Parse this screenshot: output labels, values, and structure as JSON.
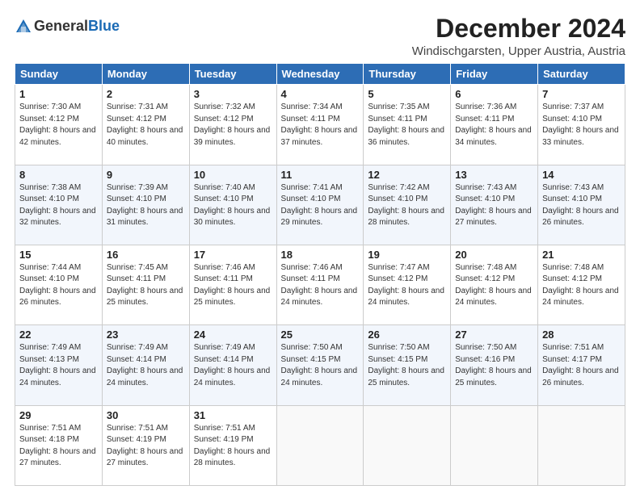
{
  "logo": {
    "line1": "General",
    "line2": "Blue"
  },
  "header": {
    "title": "December 2024",
    "subtitle": "Windischgarsten, Upper Austria, Austria"
  },
  "weekdays": [
    "Sunday",
    "Monday",
    "Tuesday",
    "Wednesday",
    "Thursday",
    "Friday",
    "Saturday"
  ],
  "weeks": [
    [
      {
        "day": "1",
        "sunrise": "7:30 AM",
        "sunset": "4:12 PM",
        "daylight": "8 hours and 42 minutes."
      },
      {
        "day": "2",
        "sunrise": "7:31 AM",
        "sunset": "4:12 PM",
        "daylight": "8 hours and 40 minutes."
      },
      {
        "day": "3",
        "sunrise": "7:32 AM",
        "sunset": "4:12 PM",
        "daylight": "8 hours and 39 minutes."
      },
      {
        "day": "4",
        "sunrise": "7:34 AM",
        "sunset": "4:11 PM",
        "daylight": "8 hours and 37 minutes."
      },
      {
        "day": "5",
        "sunrise": "7:35 AM",
        "sunset": "4:11 PM",
        "daylight": "8 hours and 36 minutes."
      },
      {
        "day": "6",
        "sunrise": "7:36 AM",
        "sunset": "4:11 PM",
        "daylight": "8 hours and 34 minutes."
      },
      {
        "day": "7",
        "sunrise": "7:37 AM",
        "sunset": "4:10 PM",
        "daylight": "8 hours and 33 minutes."
      }
    ],
    [
      {
        "day": "8",
        "sunrise": "7:38 AM",
        "sunset": "4:10 PM",
        "daylight": "8 hours and 32 minutes."
      },
      {
        "day": "9",
        "sunrise": "7:39 AM",
        "sunset": "4:10 PM",
        "daylight": "8 hours and 31 minutes."
      },
      {
        "day": "10",
        "sunrise": "7:40 AM",
        "sunset": "4:10 PM",
        "daylight": "8 hours and 30 minutes."
      },
      {
        "day": "11",
        "sunrise": "7:41 AM",
        "sunset": "4:10 PM",
        "daylight": "8 hours and 29 minutes."
      },
      {
        "day": "12",
        "sunrise": "7:42 AM",
        "sunset": "4:10 PM",
        "daylight": "8 hours and 28 minutes."
      },
      {
        "day": "13",
        "sunrise": "7:43 AM",
        "sunset": "4:10 PM",
        "daylight": "8 hours and 27 minutes."
      },
      {
        "day": "14",
        "sunrise": "7:43 AM",
        "sunset": "4:10 PM",
        "daylight": "8 hours and 26 minutes."
      }
    ],
    [
      {
        "day": "15",
        "sunrise": "7:44 AM",
        "sunset": "4:10 PM",
        "daylight": "8 hours and 26 minutes."
      },
      {
        "day": "16",
        "sunrise": "7:45 AM",
        "sunset": "4:11 PM",
        "daylight": "8 hours and 25 minutes."
      },
      {
        "day": "17",
        "sunrise": "7:46 AM",
        "sunset": "4:11 PM",
        "daylight": "8 hours and 25 minutes."
      },
      {
        "day": "18",
        "sunrise": "7:46 AM",
        "sunset": "4:11 PM",
        "daylight": "8 hours and 24 minutes."
      },
      {
        "day": "19",
        "sunrise": "7:47 AM",
        "sunset": "4:12 PM",
        "daylight": "8 hours and 24 minutes."
      },
      {
        "day": "20",
        "sunrise": "7:48 AM",
        "sunset": "4:12 PM",
        "daylight": "8 hours and 24 minutes."
      },
      {
        "day": "21",
        "sunrise": "7:48 AM",
        "sunset": "4:12 PM",
        "daylight": "8 hours and 24 minutes."
      }
    ],
    [
      {
        "day": "22",
        "sunrise": "7:49 AM",
        "sunset": "4:13 PM",
        "daylight": "8 hours and 24 minutes."
      },
      {
        "day": "23",
        "sunrise": "7:49 AM",
        "sunset": "4:14 PM",
        "daylight": "8 hours and 24 minutes."
      },
      {
        "day": "24",
        "sunrise": "7:49 AM",
        "sunset": "4:14 PM",
        "daylight": "8 hours and 24 minutes."
      },
      {
        "day": "25",
        "sunrise": "7:50 AM",
        "sunset": "4:15 PM",
        "daylight": "8 hours and 24 minutes."
      },
      {
        "day": "26",
        "sunrise": "7:50 AM",
        "sunset": "4:15 PM",
        "daylight": "8 hours and 25 minutes."
      },
      {
        "day": "27",
        "sunrise": "7:50 AM",
        "sunset": "4:16 PM",
        "daylight": "8 hours and 25 minutes."
      },
      {
        "day": "28",
        "sunrise": "7:51 AM",
        "sunset": "4:17 PM",
        "daylight": "8 hours and 26 minutes."
      }
    ],
    [
      {
        "day": "29",
        "sunrise": "7:51 AM",
        "sunset": "4:18 PM",
        "daylight": "8 hours and 27 minutes."
      },
      {
        "day": "30",
        "sunrise": "7:51 AM",
        "sunset": "4:19 PM",
        "daylight": "8 hours and 27 minutes."
      },
      {
        "day": "31",
        "sunrise": "7:51 AM",
        "sunset": "4:19 PM",
        "daylight": "8 hours and 28 minutes."
      },
      null,
      null,
      null,
      null
    ]
  ]
}
